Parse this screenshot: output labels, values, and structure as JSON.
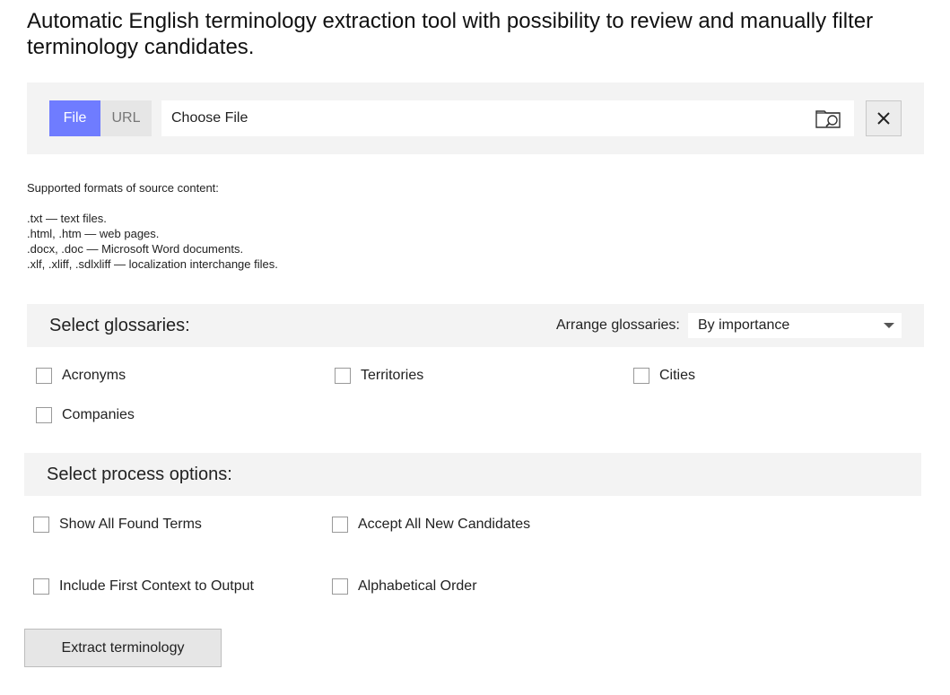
{
  "page": {
    "title": "Automatic English terminology extraction tool with possibility to review and manually filter terminology candidates."
  },
  "source": {
    "tabs": [
      {
        "label": "File",
        "active": true
      },
      {
        "label": "URL",
        "active": false
      }
    ],
    "file_input_label": "Choose File",
    "browse_icon": "folder-search-icon",
    "clear_icon": "close-icon",
    "accent_color": "#6f7cff"
  },
  "formats": {
    "heading": "Supported formats of source content:",
    "items": [
      ".txt — text files.",
      ".html, .htm — web pages.",
      ".docx, .doc — Microsoft Word documents.",
      ".xlf, .xliff, .sdlxliff — localization interchange files."
    ]
  },
  "glossaries": {
    "title": "Select glossaries:",
    "arrange_label": "Arrange glossaries:",
    "arrange_value": "By importance",
    "options": [
      {
        "label": "Acronyms",
        "checked": false
      },
      {
        "label": "Territories",
        "checked": false
      },
      {
        "label": "Cities",
        "checked": false
      },
      {
        "label": "Companies",
        "checked": false
      }
    ]
  },
  "process": {
    "title": "Select process options:",
    "options": [
      {
        "label": "Show All Found Terms",
        "checked": false
      },
      {
        "label": "Accept All New Candidates",
        "checked": false
      },
      {
        "label": "Include First Context to Output",
        "checked": false
      },
      {
        "label": "Alphabetical Order",
        "checked": false
      }
    ]
  },
  "actions": {
    "extract_label": "Extract terminology"
  }
}
